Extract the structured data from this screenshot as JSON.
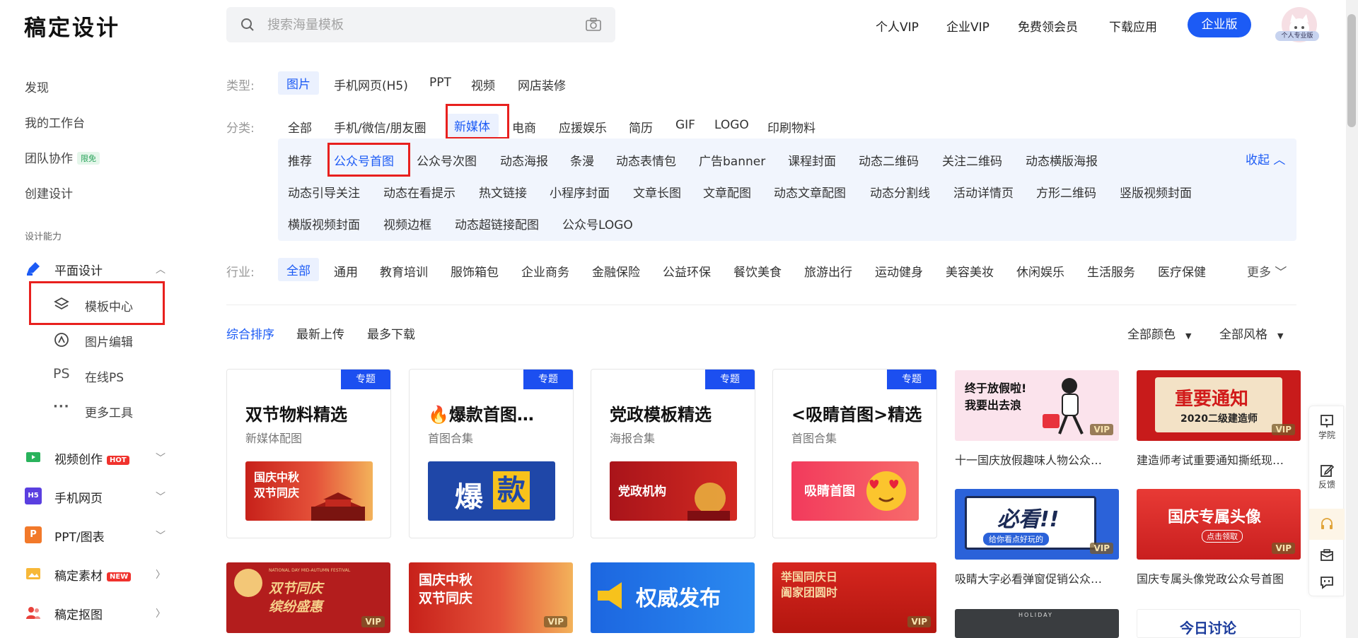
{
  "app": {
    "logo": "稿定设计"
  },
  "search": {
    "placeholder": "搜索海量模板"
  },
  "topnav": {
    "items": [
      "个人VIP",
      "企业VIP",
      "免费领会员",
      "下载应用"
    ],
    "enterprise_button": "企业版",
    "avatar_badge": "个人专业版"
  },
  "sidebar": {
    "top_items": [
      {
        "label": "发现"
      },
      {
        "label": "我的工作台"
      },
      {
        "label": "团队协作",
        "tag": "限免"
      },
      {
        "label": "创建设计"
      }
    ],
    "section_title": "设计能力",
    "design": {
      "label": "平面设计",
      "sub_items": [
        "模板中心",
        "图片编辑",
        "在线PS",
        "更多工具"
      ],
      "ps_text": "PS"
    },
    "groups": [
      {
        "label": "视频创作",
        "badge": "HOT"
      },
      {
        "label": "手机网页"
      },
      {
        "label": "PPT/图表"
      },
      {
        "label": "稿定素材",
        "badge": "NEW"
      },
      {
        "label": "稿定抠图"
      }
    ],
    "h5_icon_text": "H5",
    "p_icon_text": "P"
  },
  "filters": {
    "type_label": "类型:",
    "types": [
      "图片",
      "手机网页(H5)",
      "PPT",
      "视频",
      "网店装修"
    ],
    "category_label": "分类:",
    "categories": [
      "全部",
      "手机/微信/朋友圈",
      "新媒体",
      "电商",
      "应援娱乐",
      "简历",
      "GIF",
      "LOGO",
      "印刷物料"
    ],
    "sub_categories_row1": [
      "推荐",
      "公众号首图",
      "公众号次图",
      "动态海报",
      "条漫",
      "动态表情包",
      "广告banner",
      "课程封面",
      "动态二维码",
      "关注二维码",
      "动态横版海报"
    ],
    "sub_categories_row2": [
      "动态引导关注",
      "动态在看提示",
      "热文链接",
      "小程序封面",
      "文章长图",
      "文章配图",
      "动态文章配图",
      "动态分割线",
      "活动详情页",
      "方形二维码",
      "竖版视频封面"
    ],
    "sub_categories_row3": [
      "横版视频封面",
      "视频边框",
      "动态超链接配图",
      "公众号LOGO"
    ],
    "collapse": "收起",
    "industry_label": "行业:",
    "industries": [
      "全部",
      "通用",
      "教育培训",
      "服饰箱包",
      "企业商务",
      "金融保险",
      "公益环保",
      "餐饮美食",
      "旅游出行",
      "运动健身",
      "美容美妆",
      "休闲娱乐",
      "生活服务",
      "医疗保健"
    ],
    "more": "更多"
  },
  "sort": {
    "options": [
      "综合排序",
      "最新上传",
      "最多下载"
    ],
    "color": "全部颜色",
    "style": "全部风格"
  },
  "feature_cards": [
    {
      "tag": "专题",
      "title": "双节物料精选",
      "subtitle": "新媒体配图",
      "thumb_text": "国庆中秋\n双节同庆"
    },
    {
      "tag": "专题",
      "title": "🔥爆款首图…",
      "subtitle": "首图合集",
      "thumb_text_a": "爆",
      "thumb_text_b": "款"
    },
    {
      "tag": "专题",
      "title": "党政模板精选",
      "subtitle": "海报合集",
      "thumb_text": "党政机构"
    },
    {
      "tag": "专题",
      "title": "<吸睛首图>精选",
      "subtitle": "首图合集",
      "thumb_text": "吸睛首图"
    }
  ],
  "templates": [
    {
      "caption": "十一国庆放假趣味人物公众…",
      "img_text": "终于放假啦!\n我要出去浪",
      "vip": "VIP"
    },
    {
      "caption": "建造师考试重要通知撕纸现…",
      "img_text": "重要通知",
      "img_sub": "2020二级建造师",
      "vip": "VIP"
    },
    {
      "caption": "吸睛大字必看弹窗促销公众…",
      "img_text": "必看!!",
      "img_sub": "给你看点好玩的",
      "vip": "VIP"
    },
    {
      "caption": "国庆专属头像党政公众号首图",
      "img_text": "国庆专属头像",
      "img_sub": "点击领取",
      "vip": "VIP"
    }
  ],
  "bottom_tiles": [
    {
      "text": "双节同庆\n缤纷盛惠",
      "small": "NATIONAL DAY  MID-AUTUMN FESTIVAL",
      "vip": "VIP"
    },
    {
      "text": "国庆中秋\n双节同庆",
      "vip": "VIP"
    },
    {
      "text": "权威发布"
    },
    {
      "text": "举国同庆日\n阖家团圆时",
      "vip": "VIP"
    },
    {
      "text": "HOLIDAY"
    },
    {
      "text": "今日讨论"
    }
  ],
  "floatbar": {
    "items": [
      "学院",
      "反馈"
    ]
  },
  "colors": {
    "accent": "#1c5bf5",
    "highlight_box": "#e8201e"
  }
}
